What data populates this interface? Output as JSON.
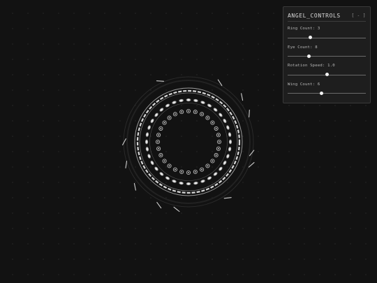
{
  "panel": {
    "title": "ANGEL_CONTROLS",
    "toggle_label": "[ - ]",
    "controls": [
      {
        "label": "Ring Count: 3",
        "value": 3,
        "min": 1,
        "max": 8
      },
      {
        "label": "Eye Count: 8",
        "value": 8,
        "min": 2,
        "max": 24
      },
      {
        "label": "Rotation Speed: 1.0",
        "value": 1.0,
        "min": 0,
        "max": 2
      },
      {
        "label": "Wing Count: 6",
        "value": 6,
        "min": 0,
        "max": 14
      }
    ]
  },
  "colors": {
    "background": "#121212",
    "ring": "#d8d8d8",
    "panel": "#1e1e1e",
    "thumb": "#f2f2f2"
  }
}
